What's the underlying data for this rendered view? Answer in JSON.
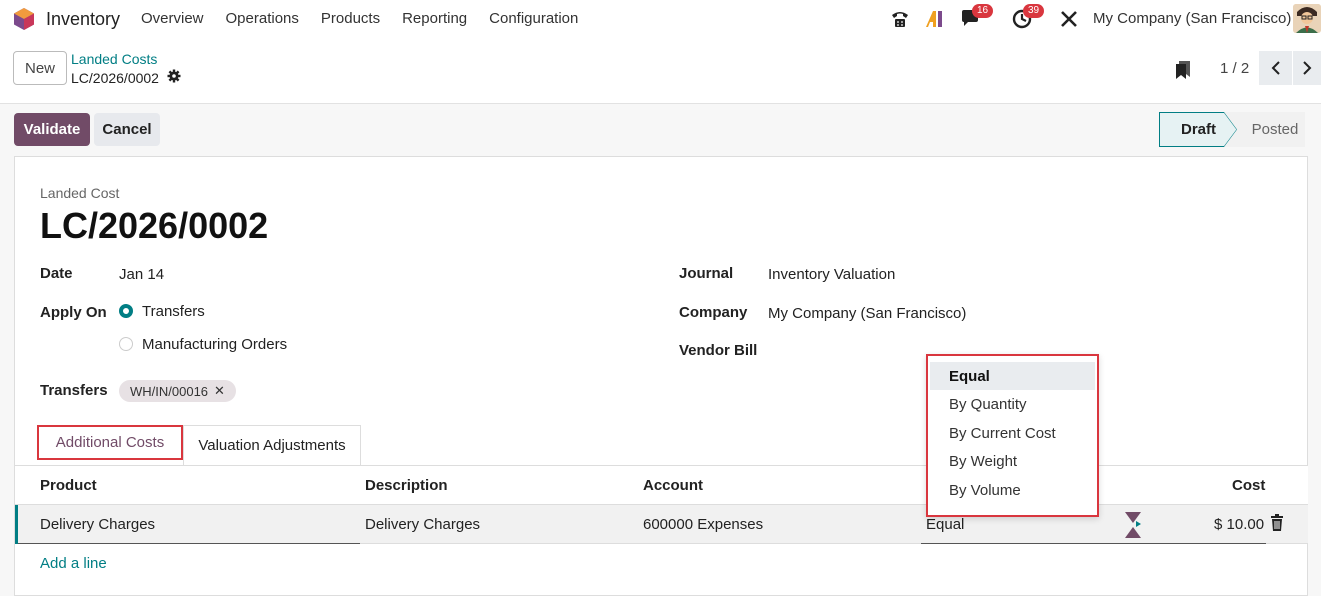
{
  "navbar": {
    "app_name": "Inventory",
    "menu": [
      "Overview",
      "Operations",
      "Products",
      "Reporting",
      "Configuration"
    ],
    "messages_count": "16",
    "activities_count": "39",
    "company": "My Company (San Francisco)"
  },
  "control_panel": {
    "new_label": "New",
    "breadcrumb_parent": "Landed Costs",
    "breadcrumb_current": "LC/2026/0002",
    "pager": "1 / 2"
  },
  "statusbar": {
    "validate_label": "Validate",
    "cancel_label": "Cancel",
    "stages": [
      "Draft",
      "Posted"
    ],
    "current_stage": "Draft"
  },
  "form": {
    "header_label": "Landed Cost",
    "title": "LC/2026/0002",
    "date_label": "Date",
    "date_value": "Jan 14",
    "apply_on_label": "Apply On",
    "apply_on_options": [
      "Transfers",
      "Manufacturing Orders"
    ],
    "apply_on_selected": "Transfers",
    "transfers_label": "Transfers",
    "transfer_tag": "WH/IN/00016",
    "journal_label": "Journal",
    "journal_value": "Inventory Valuation",
    "company_label": "Company",
    "company_value": "My Company (San Francisco)",
    "vendor_bill_label": "Vendor Bill"
  },
  "tabs": [
    "Additional Costs",
    "Valuation Adjustments"
  ],
  "table": {
    "headers": [
      "Product",
      "Description",
      "Account",
      "Cost"
    ],
    "rows": [
      {
        "product": "Delivery Charges",
        "description": "Delivery Charges",
        "account": "600000 Expenses",
        "split_method": "Equal",
        "cost": "$ 10.00"
      }
    ],
    "add_line": "Add a line"
  },
  "split_dropdown": {
    "options": [
      "Equal",
      "By Quantity",
      "By Current Cost",
      "By Weight",
      "By Volume"
    ],
    "highlighted": "Equal"
  },
  "colors": {
    "brand": "#714b67",
    "accent": "#017e84",
    "badge": "#d9363e"
  }
}
